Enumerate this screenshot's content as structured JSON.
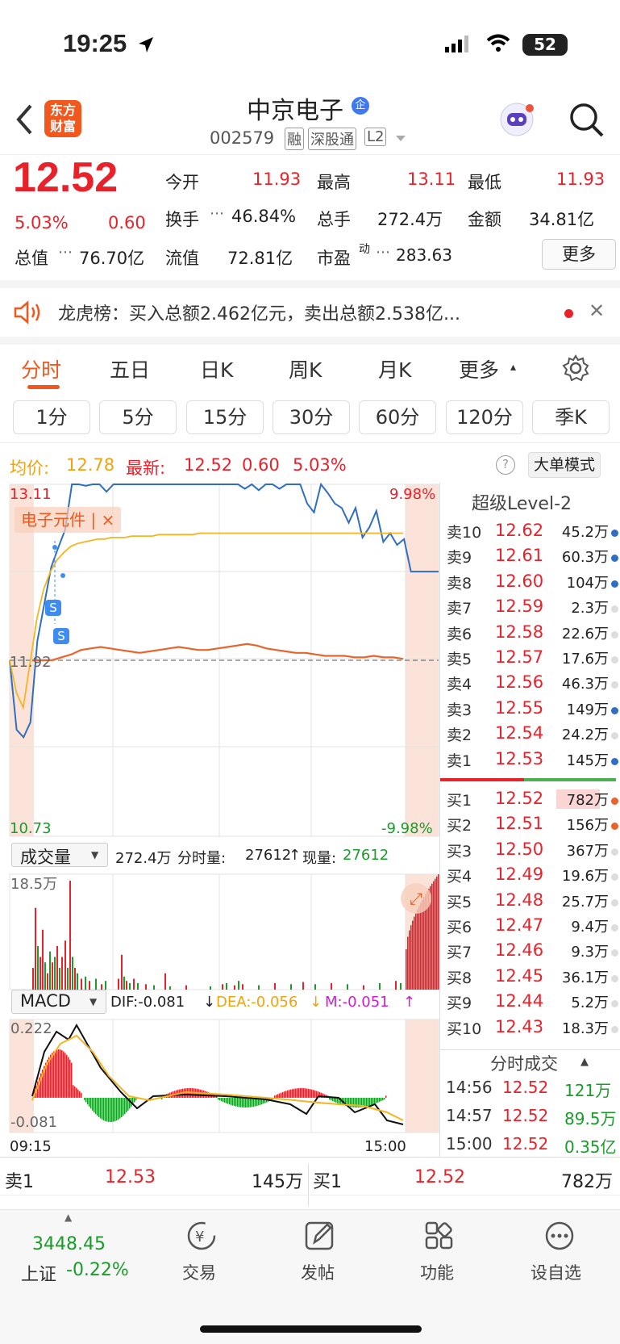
{
  "status": {
    "time": "19:25",
    "battery": "52"
  },
  "nav": {
    "logo_line1": "东方",
    "logo_line2": "财富",
    "stock_name": "中京电子",
    "badge_enterprise": "企",
    "code": "002579",
    "tag_margin": "融",
    "tag_connect": "深股通",
    "tag_l2": "L2"
  },
  "quote": {
    "price": "12.52",
    "change_pct": "5.03%",
    "change": "0.60",
    "open_label": "今开",
    "open": "11.93",
    "high_label": "最高",
    "high": "13.11",
    "low_label": "最低",
    "low": "11.93",
    "turnover_label": "换手",
    "turnover": "46.84%",
    "volume_label": "总手",
    "volume": "272.4万",
    "amount_label": "金额",
    "amount": "34.81亿",
    "mcap_label": "总值",
    "mcap": "76.70亿",
    "float_label": "流值",
    "float": "72.81亿",
    "pe_label": "市盈",
    "pe_sup": "动",
    "pe": "283.63",
    "more": "更多"
  },
  "notice": {
    "text": "龙虎榜：买入总额2.462亿元，卖出总额2.538亿..."
  },
  "tabs": {
    "t1": "分时",
    "t2": "五日",
    "t3": "日K",
    "t4": "周K",
    "t5": "月K",
    "t6": "更多",
    "more_arrow": "▴"
  },
  "periods": [
    "1分",
    "5分",
    "15分",
    "30分",
    "60分",
    "120分",
    "季K"
  ],
  "chart_header": {
    "avg_label": "均价:",
    "avg": "12.78",
    "last_label": "最新:",
    "last": "12.52",
    "chg": "0.60",
    "pct": "5.03%",
    "big_mode": "大单模式"
  },
  "chart_data": {
    "type": "line",
    "y_top": "13.11",
    "y_bottom": "10.73",
    "y_mid": "11.92",
    "pct_top": "9.98%",
    "pct_bottom": "-9.98%",
    "sector_tag": "电子元件",
    "sector_close": "×",
    "price": [
      11.92,
      11.45,
      11.4,
      11.5,
      12.05,
      12.3,
      12.55,
      12.68,
      12.8,
      13.11,
      13.11,
      13.1,
      13.11,
      13.11,
      13.06,
      13.11,
      13.11,
      13.11,
      13.11,
      13.11,
      13.11,
      13.11,
      13.11,
      13.11,
      13.11,
      13.11,
      13.11,
      13.11,
      13.11,
      13.11,
      13.11,
      13.11,
      13.11,
      13.11,
      13.08,
      13.11,
      13.07,
      13.11,
      13.11,
      13.08,
      13.11,
      13.11,
      13.11,
      12.98,
      12.92,
      13.11,
      13.05,
      12.98,
      12.95,
      12.85,
      12.95,
      12.75,
      12.82,
      12.93,
      12.72,
      12.78,
      12.7,
      12.74,
      12.52,
      12.52,
      12.52,
      12.52,
      12.52
    ],
    "avg": [
      11.92,
      11.7,
      11.6,
      11.9,
      12.2,
      12.4,
      12.52,
      12.6,
      12.65,
      12.69,
      12.71,
      12.72,
      12.73,
      12.74,
      12.74,
      12.75,
      12.75,
      12.75,
      12.76,
      12.76,
      12.76,
      12.76,
      12.77,
      12.77,
      12.77,
      12.77,
      12.77,
      12.77,
      12.78,
      12.78,
      12.78,
      12.78,
      12.78,
      12.78,
      12.78,
      12.78,
      12.78,
      12.78,
      12.78,
      12.78,
      12.78,
      12.78,
      12.78,
      12.78,
      12.78,
      12.78,
      12.78,
      12.78,
      12.78,
      12.78,
      12.78,
      12.78,
      12.78,
      12.78,
      12.78,
      12.78,
      12.78,
      12.78,
      12.78
    ],
    "sector": [
      11.92,
      11.92,
      11.92,
      11.94,
      11.96,
      11.99,
      12.0,
      12.01,
      12.0,
      11.99,
      11.98,
      11.97,
      11.98,
      11.99,
      12.0,
      12.01,
      12.0,
      11.99,
      11.99,
      12.0,
      12.01,
      12.02,
      12.03,
      12.02,
      12.0,
      11.99,
      11.98,
      11.97,
      11.97,
      11.96,
      11.95,
      11.95,
      11.95,
      11.94,
      11.94,
      11.95,
      11.94,
      11.94,
      11.93
    ],
    "signal_tags": [
      "S",
      "S"
    ],
    "volume_label": "成交量",
    "volume_total": "272.4万",
    "minute_vol_label": "分时量:",
    "minute_vol": "27612",
    "cur_vol_label": "现量:",
    "cur_vol": "27612",
    "vol_top": "18.5万",
    "macd_label": "MACD",
    "dif": "DIF:-0.081",
    "dea": "DEA:-0.056",
    "m": "M:-0.051",
    "macd_top": "0.222",
    "macd_bottom": "-0.081",
    "time_start": "09:15",
    "time_end": "15:00"
  },
  "orderbook": {
    "title": "超级Level-2",
    "asks": [
      {
        "l": "卖10",
        "p": "12.62",
        "v": "45.2万",
        "c": "#2f6ec4"
      },
      {
        "l": "卖9",
        "p": "12.61",
        "v": "60.3万",
        "c": "#2f6ec4"
      },
      {
        "l": "卖8",
        "p": "12.60",
        "v": "104万",
        "c": "#2f6ec4"
      },
      {
        "l": "卖7",
        "p": "12.59",
        "v": "2.3万",
        "c": "#ddd"
      },
      {
        "l": "卖6",
        "p": "12.58",
        "v": "22.6万",
        "c": "#ddd"
      },
      {
        "l": "卖5",
        "p": "12.57",
        "v": "17.6万",
        "c": "#ddd"
      },
      {
        "l": "卖4",
        "p": "12.56",
        "v": "46.3万",
        "c": "#ddd"
      },
      {
        "l": "卖3",
        "p": "12.55",
        "v": "149万",
        "c": "#2f6ec4"
      },
      {
        "l": "卖2",
        "p": "12.54",
        "v": "24.2万",
        "c": "#ddd"
      },
      {
        "l": "卖1",
        "p": "12.53",
        "v": "145万",
        "c": "#2f6ec4"
      }
    ],
    "bids": [
      {
        "l": "买1",
        "p": "12.52",
        "v": "782万",
        "c": "#e8642b"
      },
      {
        "l": "买2",
        "p": "12.51",
        "v": "156万",
        "c": "#e8642b"
      },
      {
        "l": "买3",
        "p": "12.50",
        "v": "367万",
        "c": "#ddd"
      },
      {
        "l": "买4",
        "p": "12.49",
        "v": "19.6万",
        "c": "#ddd"
      },
      {
        "l": "买5",
        "p": "12.48",
        "v": "25.7万",
        "c": "#ddd"
      },
      {
        "l": "买6",
        "p": "12.47",
        "v": "9.4万",
        "c": "#ddd"
      },
      {
        "l": "买7",
        "p": "12.46",
        "v": "9.3万",
        "c": "#ddd"
      },
      {
        "l": "买8",
        "p": "12.45",
        "v": "36.1万",
        "c": "#ddd"
      },
      {
        "l": "买9",
        "p": "12.44",
        "v": "5.2万",
        "c": "#ddd"
      },
      {
        "l": "买10",
        "p": "12.43",
        "v": "18.3万",
        "c": "#ddd"
      }
    ],
    "ticks_title": "分时成交",
    "ticks": [
      {
        "t": "14:56",
        "p": "12.52",
        "v": "121万"
      },
      {
        "t": "14:57",
        "p": "12.52",
        "v": "89.5万"
      },
      {
        "t": "15:00",
        "p": "12.52",
        "v": "0.35亿"
      }
    ]
  },
  "bottom_quote": {
    "ask_label": "卖1",
    "ask_price": "12.53",
    "ask_vol": "145万",
    "bid_label": "买1",
    "bid_price": "12.52",
    "bid_vol": "782万"
  },
  "tabbar": {
    "index_value": "3448.45",
    "index_name": "上证",
    "index_pct": "-0.22%",
    "trade": "交易",
    "post": "发帖",
    "func": "功能",
    "watch": "设自选"
  }
}
